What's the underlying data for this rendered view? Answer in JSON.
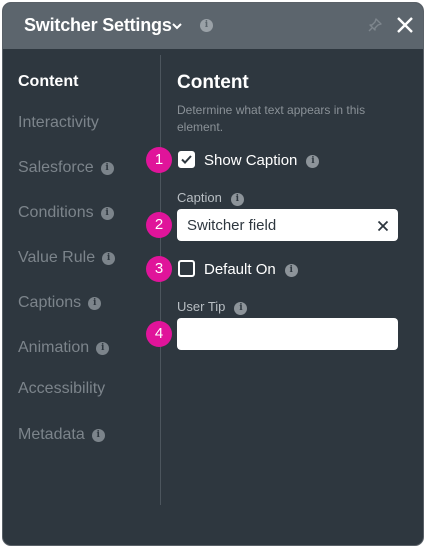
{
  "header": {
    "title": "Switcher Settings"
  },
  "sidebar": {
    "items": [
      {
        "label": "Content",
        "active": true,
        "info": false
      },
      {
        "label": "Interactivity",
        "active": false,
        "info": false
      },
      {
        "label": "Salesforce",
        "active": false,
        "info": true
      },
      {
        "label": "Conditions",
        "active": false,
        "info": true
      },
      {
        "label": "Value Rule",
        "active": false,
        "info": true
      },
      {
        "label": "Captions",
        "active": false,
        "info": true
      },
      {
        "label": "Animation",
        "active": false,
        "info": true
      },
      {
        "label": "Accessibility",
        "active": false,
        "info": false
      },
      {
        "label": "Metadata",
        "active": false,
        "info": true
      }
    ]
  },
  "content": {
    "title": "Content",
    "description": "Determine what text appears in this element.",
    "show_caption": {
      "label": "Show Caption",
      "checked": true,
      "badge": "1"
    },
    "caption": {
      "label": "Caption",
      "value": "Switcher field",
      "badge": "2"
    },
    "default_on": {
      "label": "Default On",
      "checked": false,
      "badge": "3"
    },
    "user_tip": {
      "label": "User Tip",
      "value": "",
      "badge": "4"
    }
  },
  "colors": {
    "panel_bg": "#2e373f",
    "header_bg": "#5c656d",
    "badge": "#e0149a",
    "muted_text": "#7c848b"
  },
  "icons": {
    "info": "i",
    "chevron": "chevron-down-icon",
    "pin": "pin-icon",
    "close": "close-icon",
    "clear": "clear-x-icon",
    "check": "checkmark-icon"
  }
}
